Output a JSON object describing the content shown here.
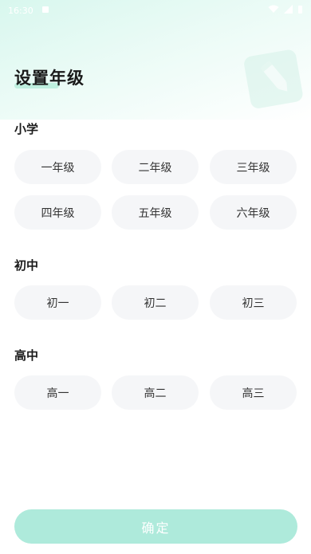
{
  "status_bar": {
    "time": "16:30"
  },
  "page": {
    "title": "设置年级"
  },
  "sections": [
    {
      "title": "小学",
      "grades": [
        "一年级",
        "二年级",
        "三年级",
        "四年级",
        "五年级",
        "六年级"
      ]
    },
    {
      "title": "初中",
      "grades": [
        "初一",
        "初二",
        "初三"
      ]
    },
    {
      "title": "高中",
      "grades": [
        "高一",
        "高二",
        "高三"
      ]
    }
  ],
  "confirm": {
    "label": "确定"
  },
  "colors": {
    "accent": "#aeeadb",
    "button_bg": "#f5f6f8",
    "header_gradient": "#d8f7ee"
  }
}
